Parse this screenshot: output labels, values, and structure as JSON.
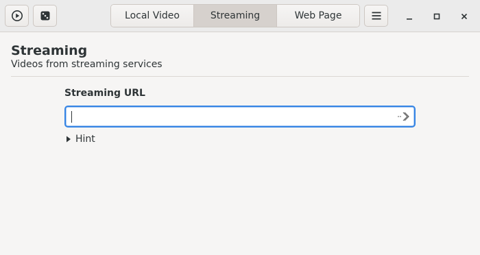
{
  "headerbar": {
    "left_buttons": [
      {
        "icon": "play-circle-icon"
      },
      {
        "icon": "dice-icon"
      }
    ],
    "tabs": [
      {
        "label": "Local Video",
        "active": false
      },
      {
        "label": "Streaming",
        "active": true
      },
      {
        "label": "Web Page",
        "active": false
      }
    ],
    "menu_icon": "hamburger-menu-icon",
    "window_controls": [
      "minimize-icon",
      "maximize-icon",
      "close-icon"
    ]
  },
  "page": {
    "title": "Streaming",
    "subtitle": "Videos from streaming services"
  },
  "form": {
    "label": "Streaming URL",
    "value": "",
    "placeholder": "",
    "go_icon": "go-next-icon"
  },
  "hint": {
    "label": "Hint",
    "expanded": false
  },
  "colors": {
    "accent": "#3584e4",
    "background": "#f6f5f4",
    "headerbar": "#ebebeb"
  }
}
